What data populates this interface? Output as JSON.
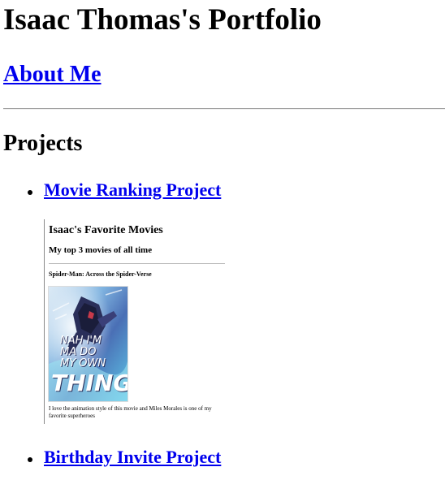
{
  "page": {
    "title": "Isaac Thomas's Portfolio",
    "about_link": "About Me",
    "projects_heading": "Projects"
  },
  "projects": [
    {
      "label": "Movie Ranking Project",
      "preview": {
        "title": "Isaac's Favorite Movies",
        "subtitle": "My top 3 movies of all time",
        "movie_title": "Spider-Man: Across the Spider-Verse",
        "poster_text": [
          "NAH I'M",
          "MA DO",
          "MY OWN",
          "THING"
        ],
        "description": "I love the animation style of this movie and Miles Morales is one of my favorite superheroes"
      }
    },
    {
      "label": "Birthday Invite Project"
    }
  ],
  "colors": {
    "link": "#0000ee",
    "text": "#000000",
    "rule": "#9a9a9a"
  }
}
